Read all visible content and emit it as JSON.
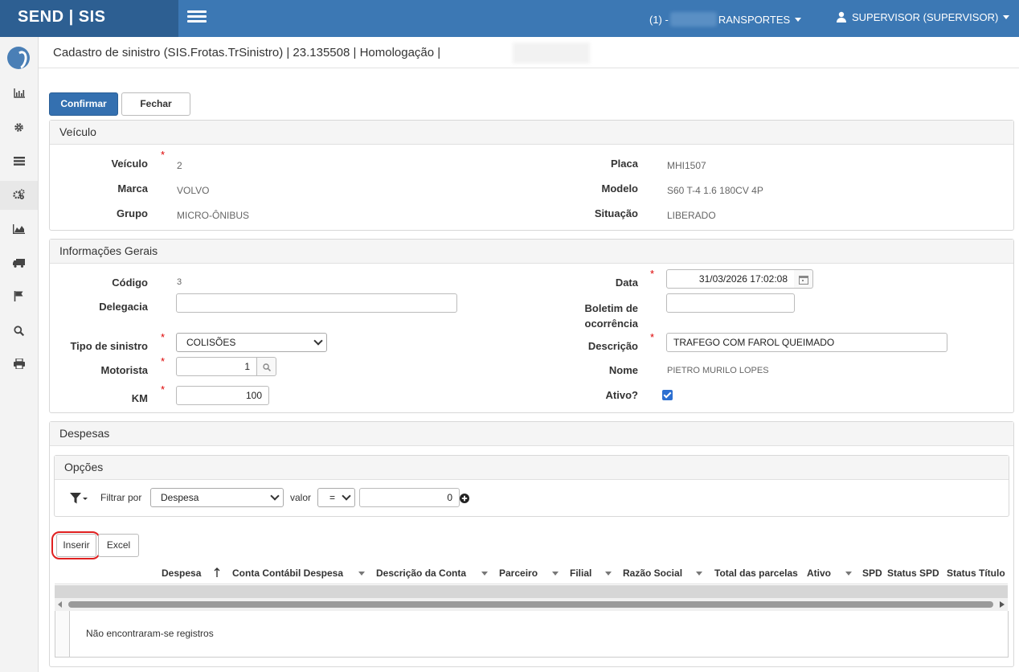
{
  "topbar": {
    "brand": "SEND | SIS",
    "company_prefix": "(1) -",
    "company_suffix": "RANSPORTES",
    "user": "SUPERVISOR (SUPERVISOR)"
  },
  "sidebar": {
    "items": [
      "chart-bar-icon",
      "gear-icon",
      "list-icon",
      "gears-icon",
      "area-chart-icon",
      "truck-icon",
      "flag-icon",
      "search-icon",
      "print-icon"
    ]
  },
  "header": {
    "title": "Cadastro de sinistro (SIS.Frotas.TrSinistro) | 23.135508 | Homologação |"
  },
  "toolbar": {
    "confirm": "Confirmar",
    "close": "Fechar"
  },
  "vehicle": {
    "title": "Veículo",
    "veiculo_label": "Veículo",
    "veiculo": "2",
    "placa_label": "Placa",
    "placa": "MHI1507",
    "marca_label": "Marca",
    "marca": "VOLVO",
    "modelo_label": "Modelo",
    "modelo": "S60 T-4 1.6 180CV 4P",
    "grupo_label": "Grupo",
    "grupo": "MICRO-ÔNIBUS",
    "situacao_label": "Situação",
    "situacao": "LIBERADO"
  },
  "info": {
    "title": "Informações Gerais",
    "codigo_label": "Código",
    "codigo": "3",
    "data_label": "Data",
    "data": "31/03/2026 17:02:08",
    "delegacia_label": "Delegacia",
    "delegacia": "",
    "boletim_label_1": "Boletim de",
    "boletim_label_2": "ocorrência",
    "boletim": "",
    "tipo_label": "Tipo de sinistro",
    "tipo": "COLISÕES",
    "descricao_label": "Descrição",
    "descricao": "TRAFEGO COM FAROL QUEIMADO",
    "motorista_label": "Motorista",
    "motorista": "1",
    "nome_label": "Nome",
    "nome": "PIETRO MURILO LOPES",
    "km_label": "KM",
    "km": "100",
    "ativo_label": "Ativo?",
    "ativo": true
  },
  "despesas": {
    "title": "Despesas",
    "options_title": "Opções",
    "filter_label": "Filtrar por",
    "filter_field": "Despesa",
    "valor_label": "valor",
    "operator": "=",
    "filter_value": "0",
    "insert": "Inserir",
    "excel": "Excel",
    "columns": [
      "Despesa",
      "Conta Contábil Despesa",
      "Descrição da Conta",
      "Parceiro",
      "Filial",
      "Razão Social",
      "Total das parcelas",
      "Ativo",
      "SPD",
      "Status SPD",
      "Status Título"
    ],
    "empty": "Não encontraram-se registros"
  },
  "colors": {
    "topbar": "#3c78b4",
    "brand_bg": "#2d5f92",
    "primary": "#3470b0",
    "required": "#dd0000",
    "highlight_ring": "#e02020"
  }
}
